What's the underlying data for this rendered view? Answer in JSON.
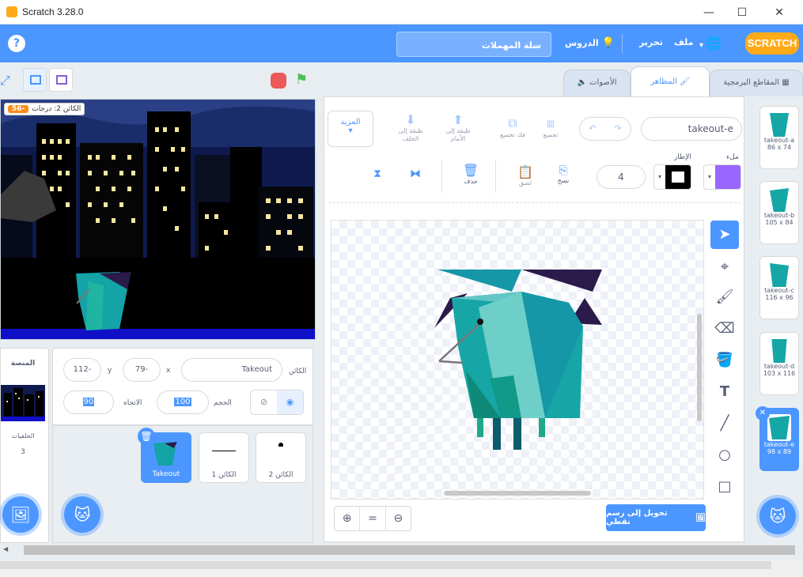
{
  "window": {
    "title": "Scratch 3.28.0"
  },
  "menu": {
    "file": "ملف",
    "edit": "تحرير",
    "tutorials": "الدروس",
    "project_title": "سلة المهملات",
    "logo": "SCRATCH"
  },
  "tabs": {
    "code": "المقاطع البرمجية",
    "costumes": "المظاهر",
    "sounds": "الأصوات"
  },
  "monitor": {
    "label": "الكائن 2: درجات",
    "value": "56-"
  },
  "sprite_info": {
    "sprite_label": "الكائن",
    "sprite_name": "Takeout",
    "x_label": "x",
    "x_value": "79-",
    "y_label": "y",
    "y_value": "112-",
    "size_label": "الحجم",
    "size_value": "100",
    "direction_label": "الاتجاه",
    "direction_value": "90"
  },
  "stage_pane": {
    "title": "المنصة",
    "backdrops_label": "الخلفيات",
    "backdrops_count": "3"
  },
  "sprites": [
    {
      "name": "Takeout"
    },
    {
      "name": "الكائن 1"
    },
    {
      "name": "الكائن 2"
    }
  ],
  "paint_toolbar": {
    "costume_name": "takeout-e",
    "group": "تجميع",
    "ungroup": "فك تجميع",
    "forward": "طبقة إلى الأمام",
    "backward": "طبقة إلى الخلف",
    "more": "المزيد",
    "fill_label": "ملء",
    "outline_label": "الإطار",
    "outline_width": "4",
    "copy": "نسخ",
    "paste": "لصق",
    "delete": "حذف",
    "convert_button": "تحويل إلى رسم نقطي",
    "fill_color": "#9966ff",
    "outline_color": "#000000"
  },
  "costumes": [
    {
      "name": "takeout-a",
      "size": "86 x 74"
    },
    {
      "name": "takeout-b",
      "size": "105 x 84"
    },
    {
      "name": "takeout-c",
      "size": "116 x 96"
    },
    {
      "name": "takeout-d",
      "size": "103 x 116"
    },
    {
      "name": "takeout-e",
      "size": "98 x 89"
    }
  ]
}
